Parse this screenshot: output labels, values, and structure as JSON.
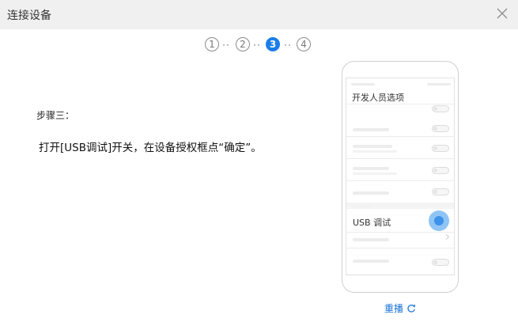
{
  "window": {
    "title": "连接设备"
  },
  "icons": {
    "close": "close-icon",
    "replay": "refresh-icon"
  },
  "stepper": {
    "steps": [
      "1",
      "2",
      "3",
      "4"
    ],
    "current": 3,
    "accent_color": "#1a7ee8"
  },
  "content": {
    "step_label": "步骤三：",
    "instruction": "打开[USB调试]开关，在设备授权框点“确定”。"
  },
  "phone": {
    "header_title": "开发人员选项",
    "usb_debug_label": "USB 调试",
    "usb_debug_enabled": true
  },
  "replay_label": "重播"
}
